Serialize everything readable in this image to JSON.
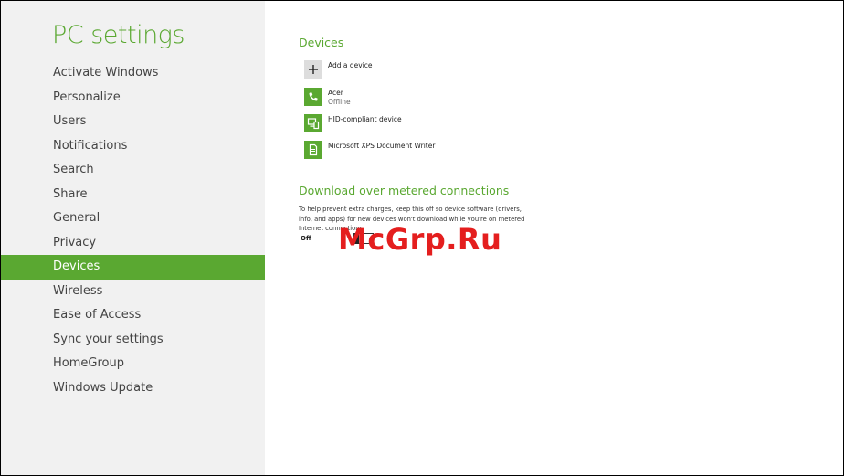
{
  "app": {
    "title": "PC settings"
  },
  "nav": {
    "items": [
      {
        "label": "Activate Windows"
      },
      {
        "label": "Personalize"
      },
      {
        "label": "Users"
      },
      {
        "label": "Notifications"
      },
      {
        "label": "Search"
      },
      {
        "label": "Share"
      },
      {
        "label": "General"
      },
      {
        "label": "Privacy"
      },
      {
        "label": "Devices",
        "selected": true
      },
      {
        "label": "Wireless"
      },
      {
        "label": "Ease of Access"
      },
      {
        "label": "Sync your settings"
      },
      {
        "label": "HomeGroup"
      },
      {
        "label": "Windows Update"
      }
    ]
  },
  "devices": {
    "title": "Devices",
    "add_label": "Add a device",
    "list": [
      {
        "name": "Acer",
        "status": "Offline",
        "icon": "phone-icon"
      },
      {
        "name": "HID-compliant device",
        "status": "",
        "icon": "devices-icon"
      },
      {
        "name": "Microsoft XPS Document Writer",
        "status": "",
        "icon": "printer-icon"
      }
    ]
  },
  "metered": {
    "title": "Download over metered connections",
    "description": "To help prevent extra charges, keep this off so device software (drivers, info, and apps) for new devices won't download while you're on metered Internet connections.",
    "toggle_label": "Off",
    "toggle_on": false
  },
  "watermark": {
    "text": "McGrp.Ru"
  },
  "colors": {
    "accent": "#5aa831",
    "sidebar_bg": "#f1f1f1",
    "watermark": "#e41e1e"
  }
}
